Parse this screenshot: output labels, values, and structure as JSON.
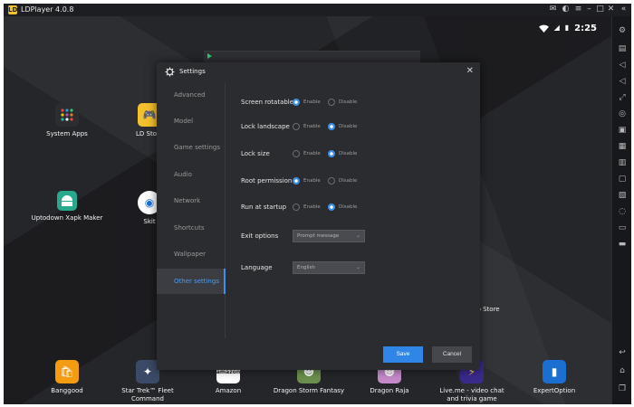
{
  "titlebar": {
    "app_title": "LDPlayer 4.0.8",
    "logo_text": "LD",
    "icons": [
      "mail-icon",
      "gamepad-icon",
      "menu-icon",
      "minimize-icon",
      "maximize-icon",
      "close-icon",
      "collapse-icon"
    ]
  },
  "statusbar": {
    "time": "2:25"
  },
  "desktop": {
    "apps": [
      {
        "label": "System Apps"
      },
      {
        "label": "LD Store"
      },
      {
        "label": "Uptodown Xapk Maker"
      },
      {
        "label": "Skit"
      },
      {
        "label": "Banggood"
      },
      {
        "label": "Star Trek™ Fleet Command"
      },
      {
        "label": "Amazon",
        "icon_text": "amazon"
      },
      {
        "label": "Dragon Storm Fantasy"
      },
      {
        "label": "Dragon Raja"
      },
      {
        "label": "Live.me - video chat and trivia game"
      },
      {
        "label": "ExpertOption"
      },
      {
        "label": "pp Store"
      }
    ]
  },
  "dialog": {
    "title": "Settings",
    "nav": [
      {
        "label": "Advanced"
      },
      {
        "label": "Model"
      },
      {
        "label": "Game settings"
      },
      {
        "label": "Audio"
      },
      {
        "label": "Network"
      },
      {
        "label": "Shortcuts"
      },
      {
        "label": "Wallpaper"
      },
      {
        "label": "Other settings",
        "active": true
      }
    ],
    "rows": [
      {
        "label": "Screen rotatable",
        "enable": "Enable",
        "disable": "Disable",
        "selected": "enable"
      },
      {
        "label": "Lock landscape",
        "enable": "Enable",
        "disable": "Disable",
        "selected": "disable"
      },
      {
        "label": "Lock size",
        "enable": "Enable",
        "disable": "Disable",
        "selected": "disable"
      },
      {
        "label": "Root permission",
        "enable": "Enable",
        "disable": "Disable",
        "selected": "enable"
      },
      {
        "label": "Run at startup",
        "enable": "Enable",
        "disable": "Disable",
        "selected": "disable"
      }
    ],
    "exit_options": {
      "label": "Exit options",
      "value": "Prompt message"
    },
    "language": {
      "label": "Language",
      "value": "English"
    },
    "save_label": "Save",
    "cancel_label": "Cancel"
  },
  "colors": {
    "accent": "#3d8fe8",
    "dialog_bg": "#2b2c2f",
    "desktop_bg": "#25262a"
  }
}
